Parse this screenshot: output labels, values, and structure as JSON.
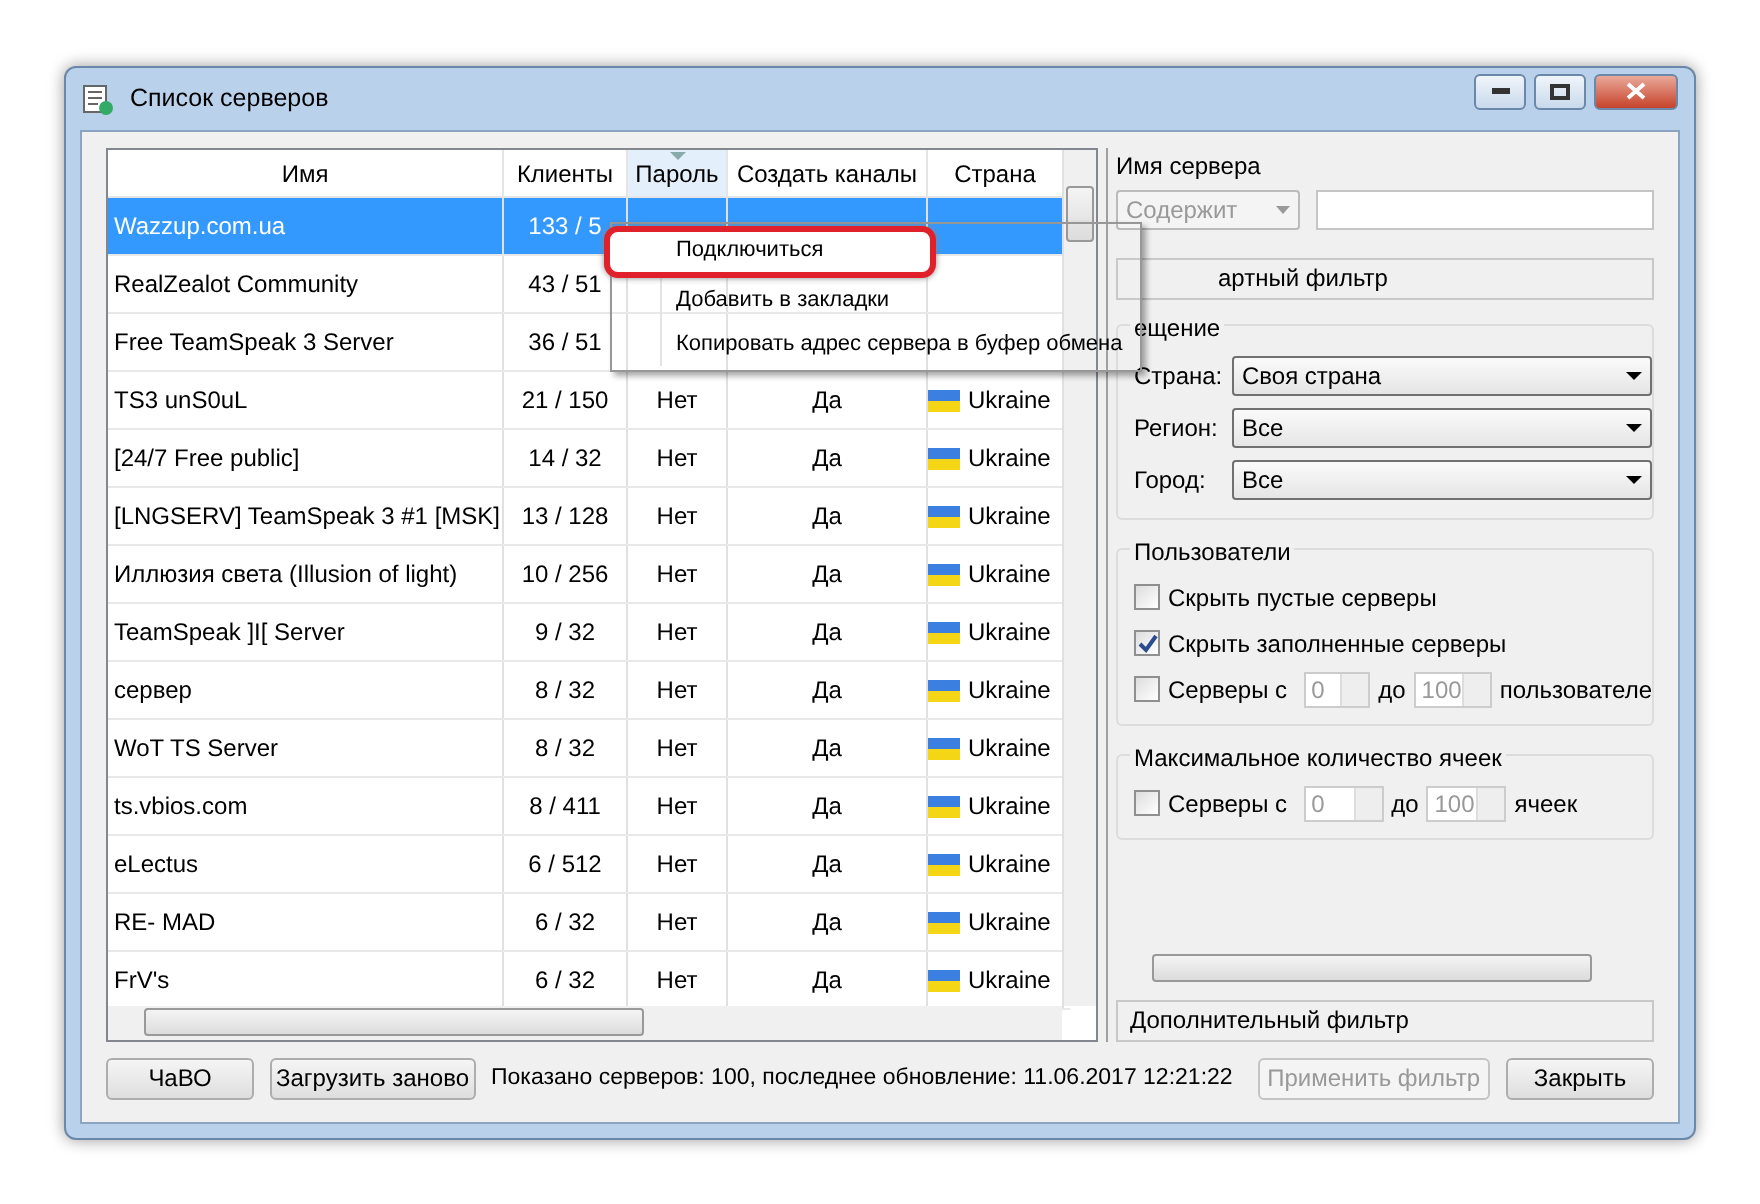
{
  "window": {
    "title": "Список серверов"
  },
  "table": {
    "columns": [
      {
        "label": "Имя",
        "sorted": false
      },
      {
        "label": "Клиенты",
        "sorted": false
      },
      {
        "label": "Пароль",
        "sorted": true
      },
      {
        "label": "Создать каналы",
        "sorted": false
      },
      {
        "label": "Страна",
        "sorted": false
      }
    ],
    "rows": [
      {
        "name": "Wazzup.com.ua",
        "clients": "133 / 5",
        "selected": true
      },
      {
        "name": "RealZealot Community",
        "clients": "43 / 51",
        "selected": false
      },
      {
        "name": "Free TeamSpeak 3 Server",
        "clients": "36 / 51",
        "selected": false
      },
      {
        "name": "TS3 unS0uL",
        "clients": "21 / 150",
        "password": "Нет",
        "create_channels": "Да",
        "country": "Ukraine",
        "selected": false
      },
      {
        "name": "[24/7 Free public]",
        "clients": "14 / 32",
        "password": "Нет",
        "create_channels": "Да",
        "country": "Ukraine",
        "selected": false
      },
      {
        "name": "[LNGSERV] TeamSpeak 3 #1 [MSK]",
        "clients": "13 / 128",
        "password": "Нет",
        "create_channels": "Да",
        "country": "Ukraine",
        "selected": false
      },
      {
        "name": "Иллюзия света (Illusion of light)",
        "clients": "10 / 256",
        "password": "Нет",
        "create_channels": "Да",
        "country": "Ukraine",
        "selected": false
      },
      {
        "name": "TeamSpeak ]I[ Server",
        "clients": "9 / 32",
        "password": "Нет",
        "create_channels": "Да",
        "country": "Ukraine",
        "selected": false
      },
      {
        "name": "сервер",
        "clients": "8 / 32",
        "password": "Нет",
        "create_channels": "Да",
        "country": "Ukraine",
        "selected": false
      },
      {
        "name": "WoT TS Server",
        "clients": "8 / 32",
        "password": "Нет",
        "create_channels": "Да",
        "country": "Ukraine",
        "selected": false
      },
      {
        "name": "ts.vbios.com",
        "clients": "8 / 411",
        "password": "Нет",
        "create_channels": "Да",
        "country": "Ukraine",
        "selected": false
      },
      {
        "name": "eLectus",
        "clients": "6 / 512",
        "password": "Нет",
        "create_channels": "Да",
        "country": "Ukraine",
        "selected": false
      },
      {
        "name": "RE- MAD",
        "clients": "6 / 32",
        "password": "Нет",
        "create_channels": "Да",
        "country": "Ukraine",
        "selected": false
      },
      {
        "name": "FrV's",
        "clients": "6 / 32",
        "password": "Нет",
        "create_channels": "Да",
        "country": "Ukraine",
        "selected": false
      }
    ]
  },
  "context_menu": {
    "items": [
      {
        "label": "Подключиться",
        "highlighted": true
      },
      {
        "label": "Добавить в закладки",
        "highlighted": false
      },
      {
        "label": "Копировать адрес сервера в буфер обмена",
        "highlighted": false
      }
    ]
  },
  "filter": {
    "server_name_label": "Имя сервера",
    "match_mode": {
      "value": "Содержит",
      "disabled": true
    },
    "standard_filter_button": "артный фильтр",
    "location": {
      "title": "ещение",
      "fields": [
        {
          "label": "Страна:",
          "value": "Своя страна"
        },
        {
          "label": "Регион:",
          "value": "Все"
        },
        {
          "label": "Город:",
          "value": "Все"
        }
      ]
    },
    "users": {
      "title": "Пользователи",
      "options": [
        {
          "kind": "check",
          "label": "Скрыть пустые серверы",
          "checked": false
        },
        {
          "kind": "check",
          "label": "Скрыть заполненные серверы",
          "checked": true
        },
        {
          "kind": "range",
          "label": "Серверы с",
          "checked": false,
          "from": "0",
          "to_label": "до",
          "to": "100",
          "suffix": "пользователе"
        }
      ]
    },
    "slots": {
      "title": "Максимальное количество ячеек",
      "options": [
        {
          "kind": "range",
          "label": "Серверы с",
          "checked": false,
          "from": "0",
          "to_label": "до",
          "to": "100",
          "suffix": "ячеек"
        }
      ]
    },
    "advanced_filter_button": "Дополнительный фильтр"
  },
  "bottom_bar": {
    "faq_button": "ЧаВО",
    "reload_button": "Загрузить заново",
    "status": "Показано серверов: 100, последнее обновление: 11.06.2017 12:21:22",
    "apply_button": {
      "label": "Применить фильтр",
      "disabled": true
    },
    "close_button": "Закрыть"
  }
}
